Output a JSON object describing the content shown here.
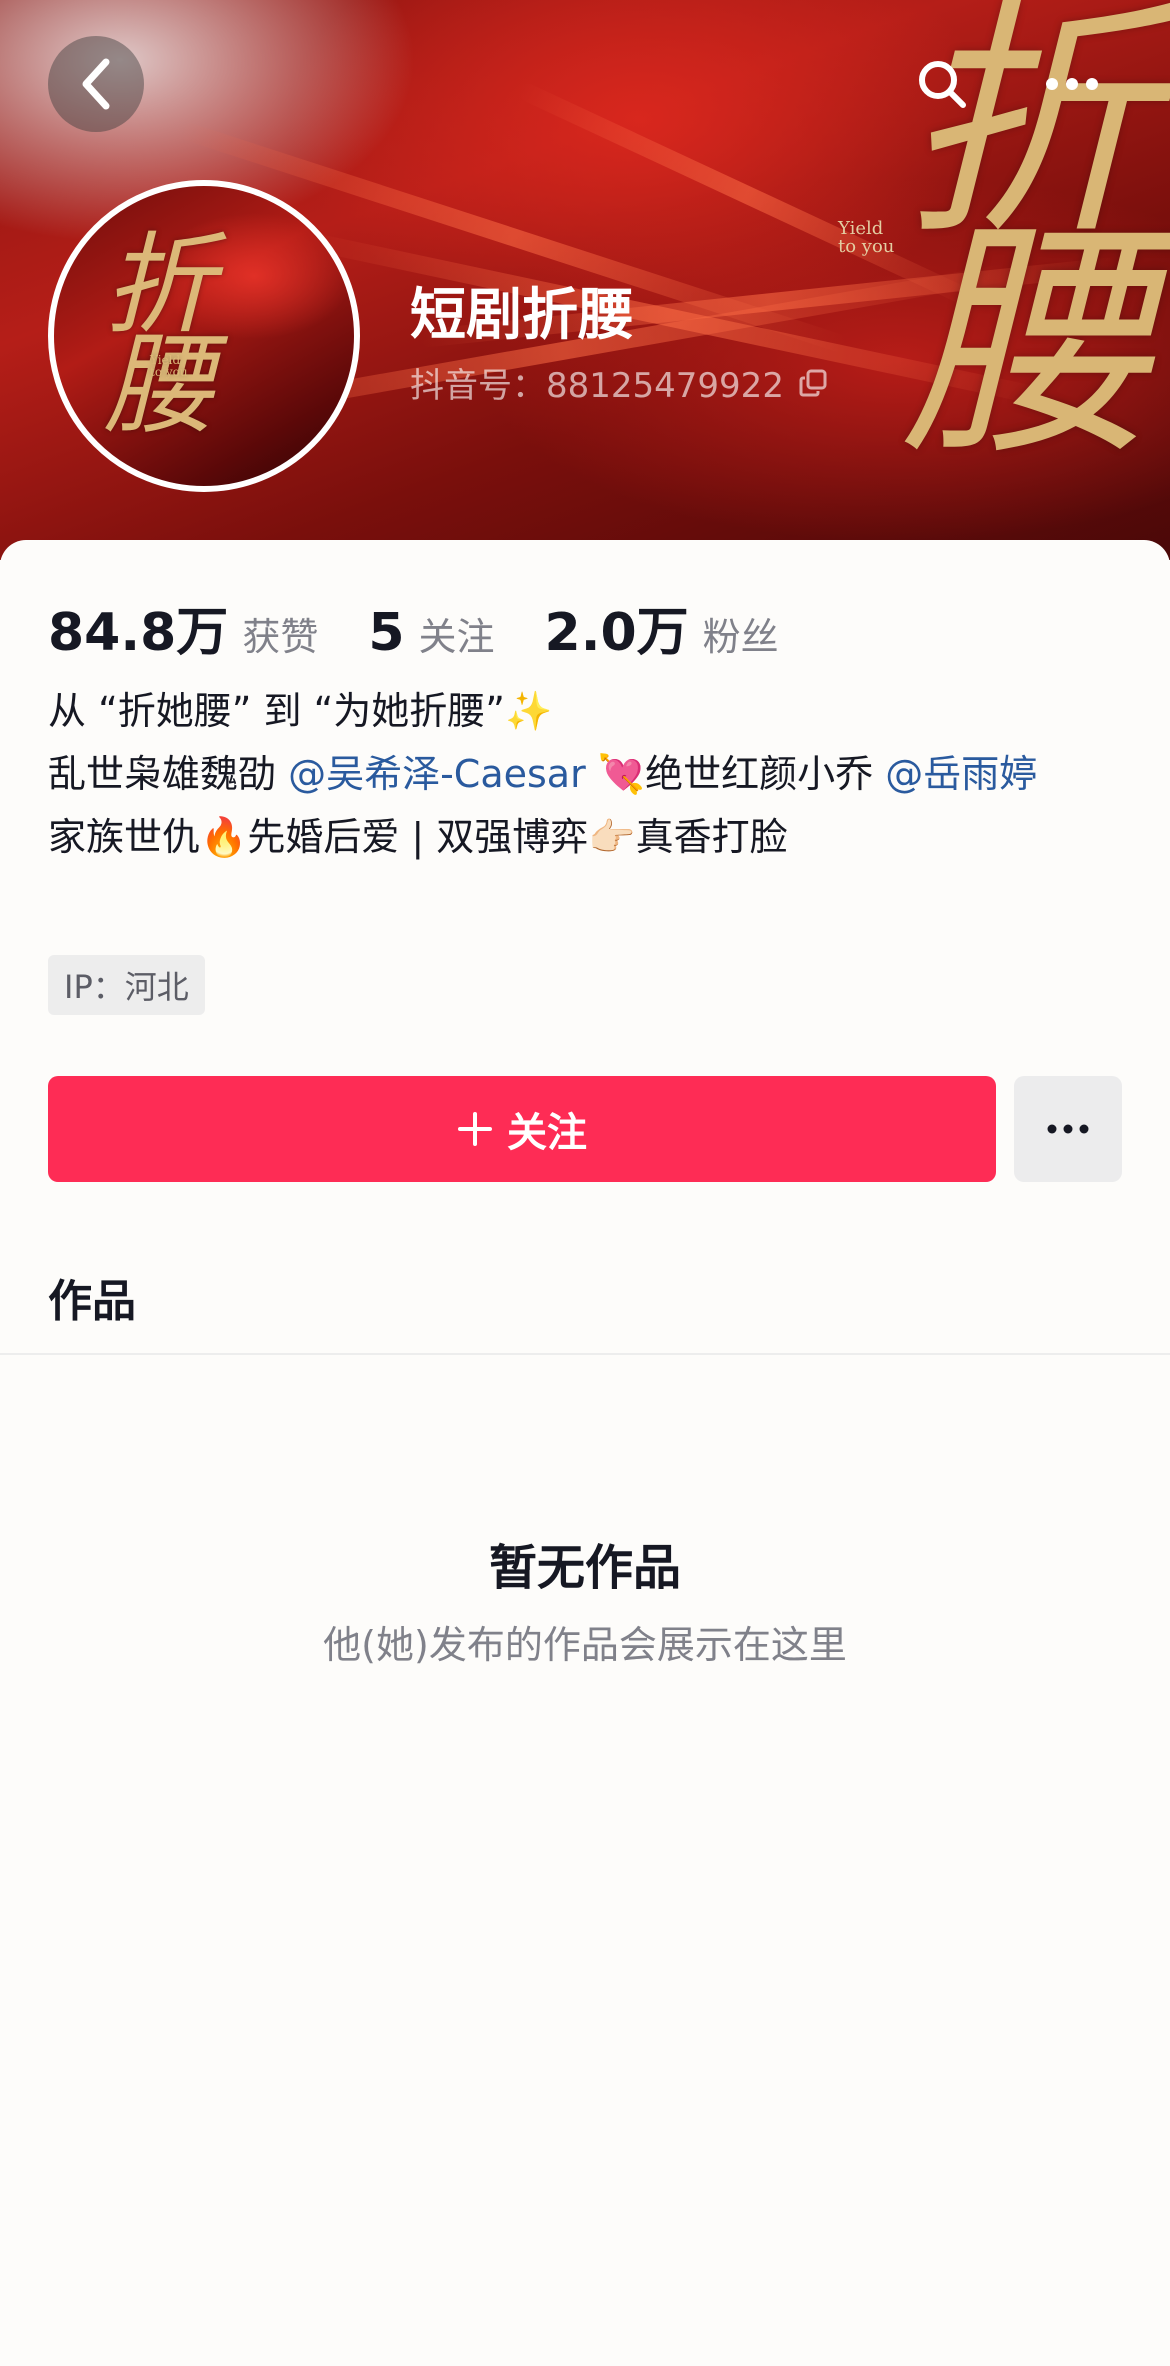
{
  "header": {
    "banner_title": "折腰",
    "banner_subtitle": "Yield to you",
    "back_icon": "chevron-left-icon",
    "search_icon": "search-icon",
    "more_icon": "more-horizontal-icon"
  },
  "profile": {
    "name": "短剧折腰",
    "douyin_id_label": "抖音号：88125479922",
    "copy_icon": "copy-icon",
    "avatar_title": "折腰",
    "avatar_subtitle": "Yield to you"
  },
  "stats": [
    {
      "value": "84.8万",
      "label": "获赞"
    },
    {
      "value": "5",
      "label": "关注"
    },
    {
      "value": "2.0万",
      "label": "粉丝"
    }
  ],
  "bio": {
    "line1": "从 “折她腰” 到 “为她折腰”✨",
    "line2_prefix": "乱世枭雄魏劭 ",
    "mention1": "@吴希泽-Caesar",
    "line2_middle": " 💘绝世红颜小乔 ",
    "mention2": "@岳雨婷",
    "line3": "家族世仇🔥先婚后爱 | 双强博弈👉🏻真香打脸"
  },
  "ip": "IP：河北",
  "actions": {
    "follow_label": "关注",
    "follow_icon": "plus-icon",
    "more_icon": "more-horizontal-icon"
  },
  "tabs": {
    "works": "作品"
  },
  "empty_state": {
    "title": "暂无作品",
    "subtitle": "他(她)发布的作品会展示在这里"
  },
  "colors": {
    "accent": "#fe2c55",
    "mention": "#2a5a9e",
    "text_primary": "#161823",
    "text_secondary": "#80818a"
  }
}
